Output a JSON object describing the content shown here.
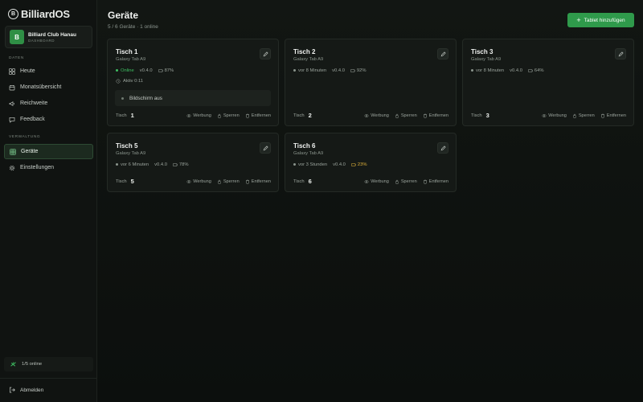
{
  "brand": {
    "name": "BilliardOS",
    "logo_letter": "B"
  },
  "club": {
    "avatar": "B",
    "name": "Billiard Club Hanau",
    "sub": "DASHBOARD"
  },
  "sections": {
    "data": "DATEN",
    "admin": "VERWALTUNG"
  },
  "nav": {
    "today": "Heute",
    "month": "Monatsübersicht",
    "reach": "Reichweite",
    "feedback": "Feedback",
    "devices": "Geräte",
    "settings": "Einstellungen"
  },
  "online_status": "1/5 online",
  "logout": "Abmelden",
  "page": {
    "title": "Geräte",
    "subtitle": "5 / 6 Geräte · 1 online",
    "add_button": "Tablet hinzufügen"
  },
  "labels": {
    "table": "Tisch",
    "ad": "Werbung",
    "lock": "Sperren",
    "remove": "Entfernen"
  },
  "colors": {
    "accent": "#2f9a4b",
    "online": "#3fbf62",
    "battery_low": "#e0b23a"
  },
  "cards": [
    {
      "title": "Tisch 1",
      "model": "Galaxy Tab A9",
      "status": "Online",
      "version": "v0.4.0",
      "battery": "87%",
      "active": "Aktiv 0:11",
      "screen": "Bildschirm aus",
      "table_no": "1"
    },
    {
      "title": "Tisch 2",
      "model": "Galaxy Tab A9",
      "status": "vor 8 Minuten",
      "version": "v0.4.0",
      "battery": "92%",
      "table_no": "2"
    },
    {
      "title": "Tisch 3",
      "model": "Galaxy Tab A9",
      "status": "vor 8 Minuten",
      "version": "v0.4.0",
      "battery": "64%",
      "table_no": "3"
    },
    {
      "title": "Tisch 5",
      "model": "Galaxy Tab A9",
      "status": "vor 6 Minuten",
      "version": "v0.4.0",
      "battery": "78%",
      "table_no": "5"
    },
    {
      "title": "Tisch 6",
      "model": "Galaxy Tab A9",
      "status": "vor 3 Stunden",
      "version": "v0.4.0",
      "battery": "23%",
      "table_no": "6"
    }
  ]
}
